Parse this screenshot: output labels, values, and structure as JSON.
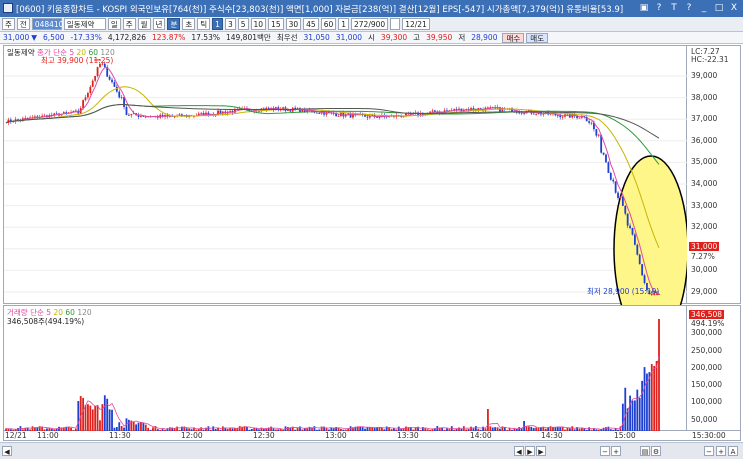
{
  "window": {
    "title": "[0600] 키움종합차트 - KOSPI 외국인보유[764(천)] 주식수[23,803(천)] 액면[1,000] 자본금[238(억)] 결산[12월] EPS[-547] 시가총액[7,379(억)] 유통비율[53.9]",
    "controls": [
      "▣",
      "?",
      "T",
      "?",
      "_",
      "□",
      "X"
    ]
  },
  "toolbar": {
    "items": [
      "주",
      "전",
      "048410",
      "일동제약",
      "일",
      "주",
      "월",
      "년",
      "분",
      "초",
      "틱",
      "1",
      "3",
      "5",
      "10",
      "15",
      "30",
      "45",
      "60",
      "1",
      "272/900",
      "12/21"
    ],
    "code_value": "048410",
    "name_value": "일동제약"
  },
  "quote": {
    "price": "31,000",
    "direction": "▼",
    "change": "6,500",
    "change_pct": "-17.33%",
    "volume": "4,172,826",
    "turnover_pct": "123.87%",
    "ratio": "17.53%",
    "amount": "149,801백만",
    "best_label": "최우선",
    "bid": "31,050",
    "ask": "31,000",
    "open_label": "시",
    "open": "39,300",
    "high_label": "고",
    "high": "39,950",
    "low_label": "저",
    "low": "28,900",
    "buy_label": "매수",
    "sell_label": "매도"
  },
  "price_panel": {
    "legend_name": "일동제약",
    "legend_ma": [
      "종가 단순 5",
      "20",
      "60",
      "120"
    ],
    "high_marker": "최고 39,900 (11:25)",
    "low_marker": "최저 28,900 (15:19)",
    "lc_label": "LC:7.27",
    "hc_label": "HC:-22.31",
    "current_tag": "31,000",
    "current_pct": "7.27%",
    "y_ticks": [
      "39,000",
      "38,000",
      "37,000",
      "36,000",
      "35,000",
      "34,000",
      "33,000",
      "32,000",
      "31,000",
      "30,000",
      "29,000"
    ]
  },
  "volume_panel": {
    "legend": [
      "거래량 단순 5",
      "20",
      "60",
      "120"
    ],
    "summary": "346,508주(494.19%)",
    "current_tag": "346,508",
    "current_pct": "494.19%",
    "y_ticks": [
      "300,000",
      "250,000",
      "200,000",
      "150,000",
      "100,000",
      "50,000"
    ]
  },
  "x_axis": {
    "labels": [
      "12/21",
      "11:00",
      "11:30",
      "12:00",
      "12:30",
      "13:00",
      "13:30",
      "14:00",
      "14:30",
      "15:00",
      "15:30:00"
    ]
  },
  "colors": {
    "up": "#e0201a",
    "down": "#1e3fd0",
    "ma5": "#e04aa0",
    "ma20": "#c8b400",
    "ma60": "#2e9a3a",
    "ma120": "#555555",
    "highlight": "#fff68a"
  }
}
